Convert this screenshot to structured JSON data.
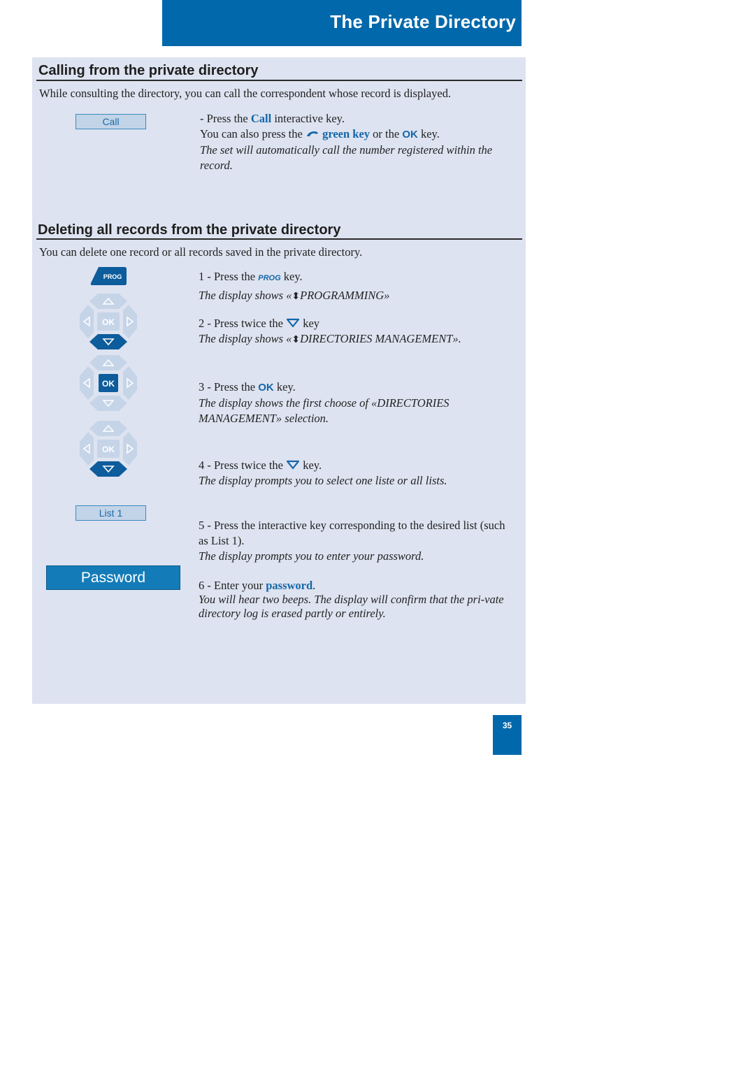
{
  "header": {
    "title": "The Private Directory"
  },
  "section1": {
    "title": "Calling from the private directory",
    "intro": "While consulting the directory, you can call the correspondent whose record is displayed.",
    "softkey_label": "Call",
    "line1_prefix": "- Press the ",
    "line1_key": "Call",
    "line1_suffix": " interactive key.",
    "line2_prefix": "You can also press the ",
    "line2_key": "green key",
    "line2_mid": " or the ",
    "line2_ok": "OK",
    "line2_suffix": " key.",
    "note": "The set will automatically call the number registered within the record."
  },
  "section2": {
    "title": "Deleting all records from the private directory",
    "intro": "You can delete one record or all records saved in the private directory.",
    "prog_key_label": "PROG",
    "ok_label": "OK",
    "list_softkey_label": "List 1",
    "password_key_label": "Password",
    "steps": [
      {
        "prefix": "1 - Press the ",
        "key": "PROG",
        "suffix": " key.",
        "note_prefix": "The display shows «",
        "note_icon": "⬍",
        "note_suffix": "PROGRAMMING»"
      },
      {
        "prefix": "2 - Press twice the ",
        "key": "down-arrow",
        "suffix": " key",
        "note_prefix": "The display shows «",
        "note_icon": "⬍",
        "note_suffix": "DIRECTORIES MANAGEMENT»."
      },
      {
        "prefix": "3 - Press the ",
        "key": "OK",
        "suffix": " key.",
        "note": "The display shows the first choose of «DIRECTORIES MANAGEMENT» selection."
      },
      {
        "prefix": "4 - Press twice the ",
        "key": "down-arrow",
        "suffix": " key.",
        "note": "The display prompts you to select one liste or all lists."
      },
      {
        "text": "5 - Press the interactive key corresponding to the desired list (such as List 1).",
        "note": "The display prompts you to enter your password."
      },
      {
        "prefix": "6 - Enter your ",
        "key": "password",
        "suffix": ".",
        "note": "You will hear two beeps. The display will confirm that the pri-vate directory log is erased partly or entirely."
      }
    ]
  },
  "page_number": "35",
  "colors": {
    "brand_blue": "#0068ab",
    "panel_bg": "#dde3f0",
    "key_light": "#c2d4e8",
    "key_dark": "#0d5c9c"
  }
}
